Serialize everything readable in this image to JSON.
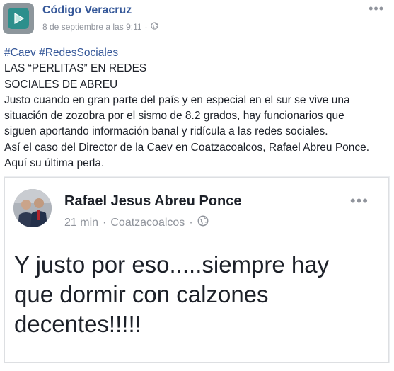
{
  "post": {
    "page_name": "Código Veracruz",
    "timestamp": "8 de septiembre a las 9:11",
    "separator": "·",
    "hashtags": [
      "#Caev",
      "#RedesSociales"
    ],
    "lines": [
      "LAS “PERLITAS” EN REDES",
      "SOCIALES DE ABREU",
      "Justo cuando en gran parte del país y en especial en el sur se vive una",
      "situación de zozobra por el sismo de 8.2 grados, hay funcionarios que",
      "siguen aportando información banal y ridícula a las redes sociales.",
      "Así el caso del Director de la Caev en Coatzacoalcos, Rafael Abreu Ponce.",
      "Aquí su última perla."
    ]
  },
  "shared_post": {
    "author": "Rafael Jesus Abreu Ponce",
    "time": "21 min",
    "separator": "·",
    "location": "Coatzacoalcos",
    "lines": [
      "Y justo por eso.....siempre hay",
      "que dormir con calzones",
      "decentes!!!!!"
    ]
  },
  "icons": {
    "page_logo": "play-logo-icon",
    "privacy": "globe-icon",
    "menu": "more-options-icon"
  },
  "colors": {
    "link": "#365899",
    "meta": "#90949c",
    "text": "#1d2129",
    "logo_bg": "#2c8f8c"
  }
}
